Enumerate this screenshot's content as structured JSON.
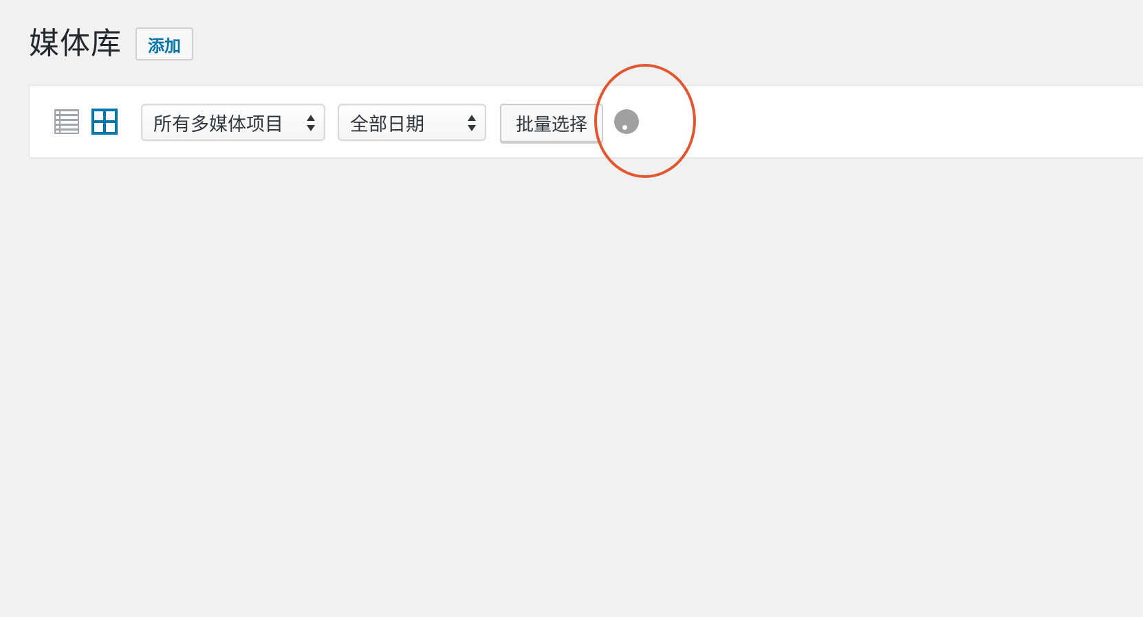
{
  "header": {
    "title": "媒体库",
    "add_button_label": "添加"
  },
  "toolbar": {
    "view_modes": [
      {
        "name": "list",
        "icon": "list-view-icon",
        "active": false
      },
      {
        "name": "grid",
        "icon": "grid-view-icon",
        "active": true
      }
    ],
    "media_type_filter": {
      "selected": "所有多媒体项目"
    },
    "date_filter": {
      "selected": "全部日期"
    },
    "bulk_select_label": "批量选择",
    "loading": true
  },
  "annotation": {
    "type": "highlight-circle",
    "color": "#e2572f"
  },
  "colors": {
    "accent": "#0073aa",
    "background": "#f1f1f1",
    "inactive_icon": "#a0a5aa"
  }
}
